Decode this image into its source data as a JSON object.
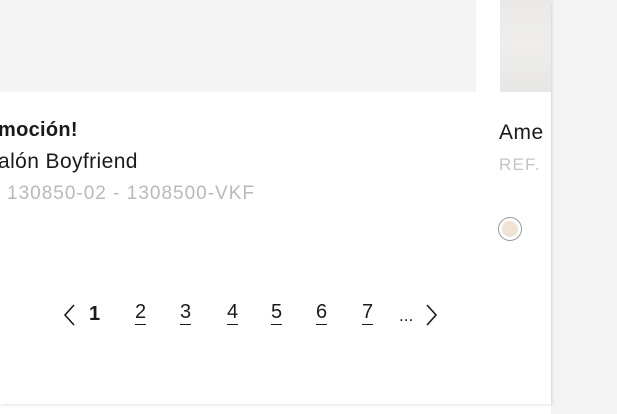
{
  "card1": {
    "promo_label": "moción!",
    "product_name": "alón Boyfriend",
    "references": "130850-02  -  1308500-VKF"
  },
  "card2": {
    "title": "Ame",
    "ref_label": "REF.",
    "swatch_color": "#efe3d6"
  },
  "pagination": {
    "prev_icon": "chevron-left-icon",
    "next_icon": "chevron-right-icon",
    "pages": [
      "1",
      "2",
      "3",
      "4",
      "5",
      "6",
      "7"
    ],
    "current_page": "1",
    "ellipsis": "..."
  }
}
